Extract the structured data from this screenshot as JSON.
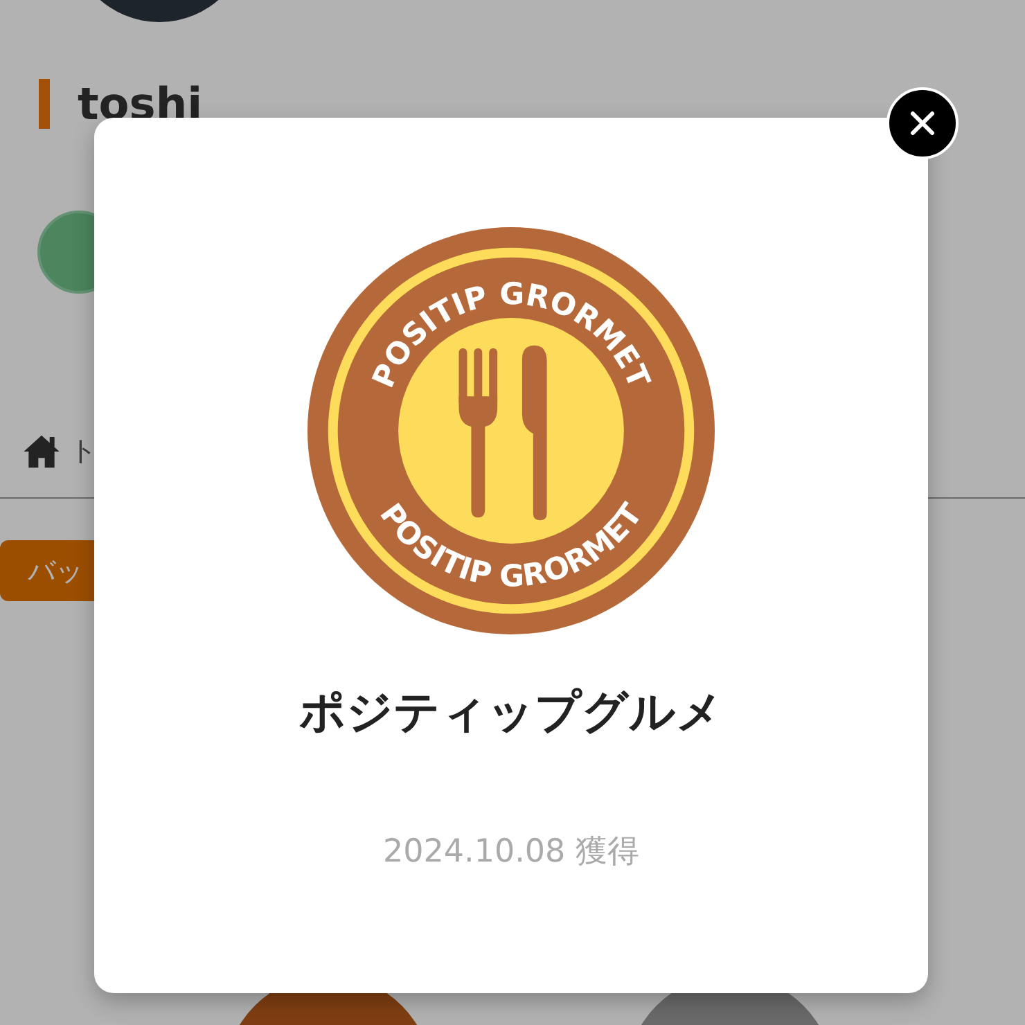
{
  "profile": {
    "name": "toshi"
  },
  "nav": {
    "breadcrumb": "ト"
  },
  "tabs": [
    {
      "label": "バッ",
      "selected": true
    }
  ],
  "modal": {
    "badge": {
      "ring_text_top": "POSITIP GRORMET",
      "ring_text_bottom": "POSITIP GRORMET"
    },
    "title": "ポジティップグルメ",
    "earned": "2024.10.08 獲得"
  }
}
